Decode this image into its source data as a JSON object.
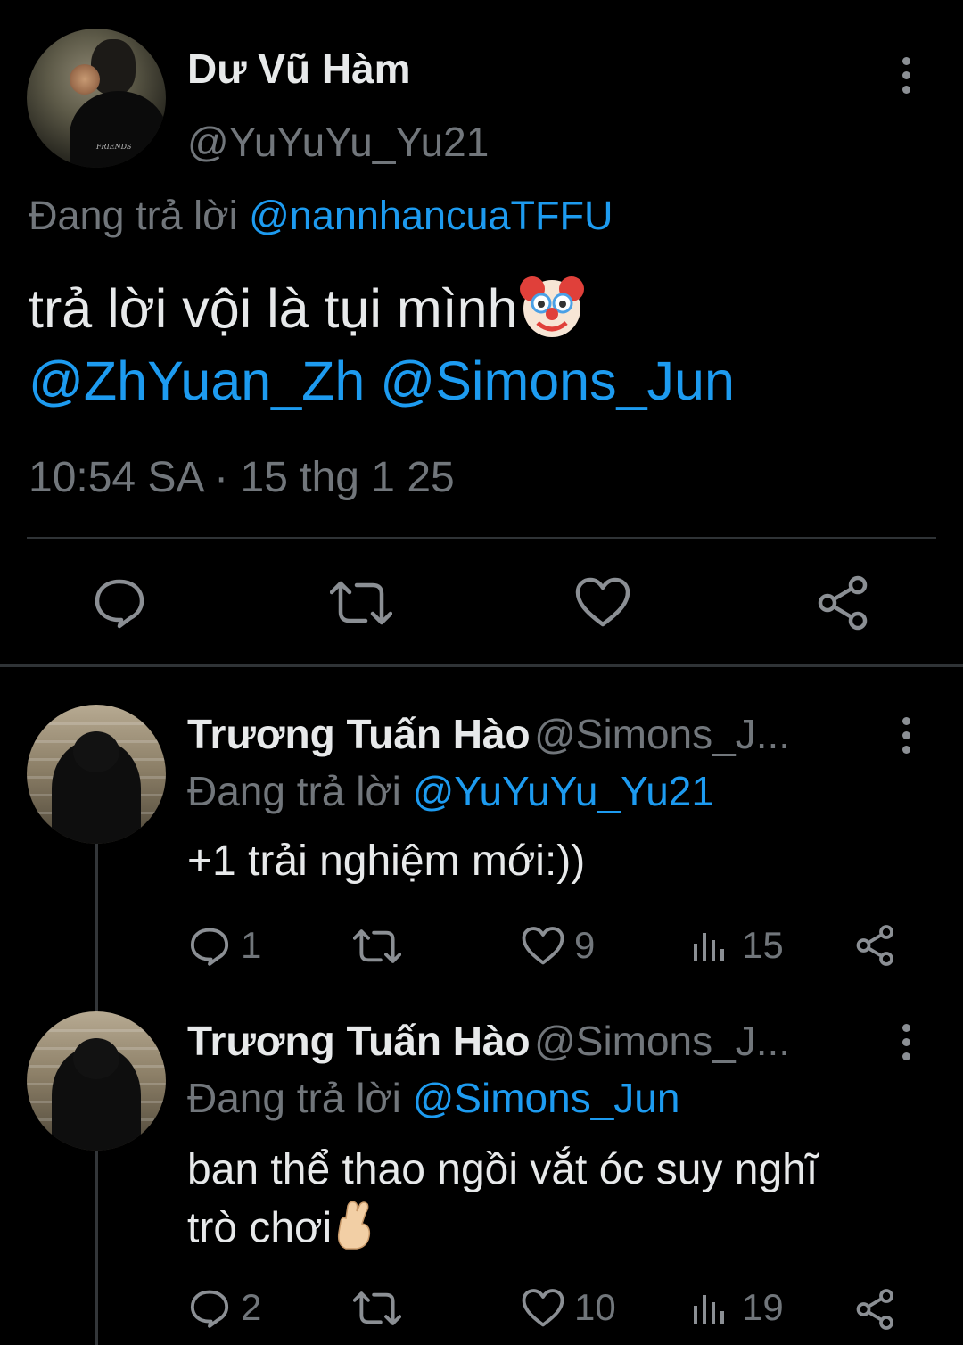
{
  "main_tweet": {
    "author_name": "Dư Vũ Hàm",
    "author_handle": "@YuYuYu_Yu21",
    "replying_prefix": "Đang trả lời",
    "replying_to": "@nannhancuaTFFU",
    "text": "trả lời vội là tụi mình",
    "text_emoji": "clown-face",
    "mentions": [
      "@ZhYuan_Zh",
      "@Simons_Jun"
    ],
    "timestamp": "10:54 SA · 15 thg 1 25",
    "actions": [
      "reply-icon",
      "retweet-icon",
      "like-icon",
      "share-icon"
    ]
  },
  "replies": [
    {
      "author_name": "Trương Tuấn Hào",
      "author_handle": "@Simons_J...",
      "replying_prefix": "Đang trả lời",
      "replying_to": "@YuYuYu_Yu21",
      "text": "+1 trải nghiệm mới:))",
      "reply_count": "1",
      "like_count": "9",
      "view_count": "15"
    },
    {
      "author_name": "Trương Tuấn Hào",
      "author_handle": "@Simons_J...",
      "replying_prefix": "Đang trả lời",
      "replying_to": "@Simons_Jun",
      "text_line1": "ban thể thao ngồi vắt óc suy nghĩ",
      "text_line2": "trò chơi",
      "text_emoji": "crossed-fingers",
      "reply_count": "2",
      "like_count": "10",
      "view_count": "19"
    }
  ],
  "colors": {
    "background": "#000000",
    "text": "#e7e9ea",
    "secondary": "#71767b",
    "link": "#1d9bf0",
    "divider": "#2f3336"
  }
}
